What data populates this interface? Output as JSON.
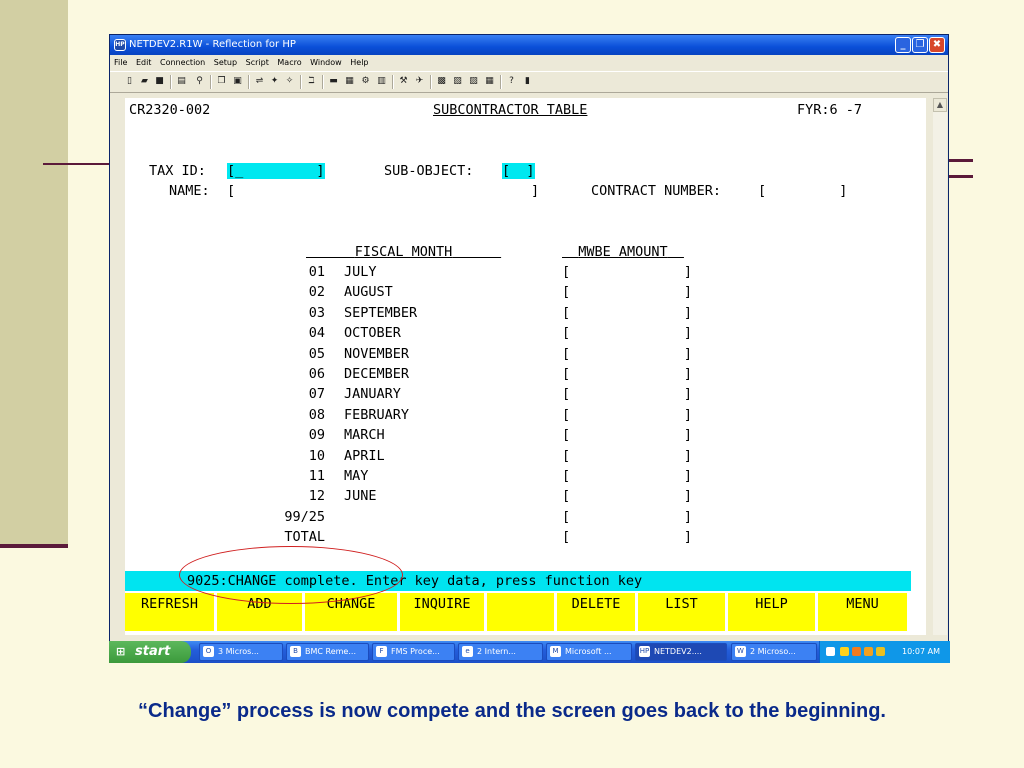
{
  "window": {
    "title": "NETDEV2.R1W - Reflection for HP",
    "app_icon": "HP",
    "buttons": {
      "minimize": "_",
      "maximize": "❐",
      "close": "✖"
    }
  },
  "menu": [
    "File",
    "Edit",
    "Connection",
    "Setup",
    "Script",
    "Macro",
    "Window",
    "Help"
  ],
  "toolbar_icons": [
    "new-icon",
    "open-icon",
    "save-icon",
    "print-icon",
    "find-icon",
    "copy-icon",
    "paste-icon",
    "connect-icon",
    "transfer-icon",
    "receive-icon",
    "macro-icon",
    "display-icon",
    "keyboard-icon",
    "settings-icon",
    "upload-icon",
    "tools-icon",
    "window-icon",
    "script-icon",
    "edit-icon",
    "terminal-icon",
    "help-cursor-icon",
    "book-icon"
  ],
  "terminal": {
    "screen_id": "CR2320-002",
    "screen_title": "SUBCONTRACTOR TABLE",
    "fyr": "FYR:6 -7",
    "tax_id_label": "TAX ID:",
    "tax_id_value": "[_         ]",
    "sub_object_label": "SUB-OBJECT:",
    "sub_object_value": "[  ]",
    "name_label": "NAME:",
    "name_open": "[",
    "name_close": "]",
    "contract_label": "CONTRACT NUMBER:",
    "contract_value": "[         ]",
    "col_fiscal_month": "FISCAL MONTH",
    "col_mwbe": "MWBE AMOUNT",
    "rows": [
      {
        "num": "01",
        "month": "JULY"
      },
      {
        "num": "02",
        "month": "AUGUST"
      },
      {
        "num": "03",
        "month": "SEPTEMBER"
      },
      {
        "num": "04",
        "month": "OCTOBER"
      },
      {
        "num": "05",
        "month": "NOVEMBER"
      },
      {
        "num": "06",
        "month": "DECEMBER"
      },
      {
        "num": "07",
        "month": "JANUARY"
      },
      {
        "num": "08",
        "month": "FEBRUARY"
      },
      {
        "num": "09",
        "month": "MARCH"
      },
      {
        "num": "10",
        "month": "APRIL"
      },
      {
        "num": "11",
        "month": "MAY"
      },
      {
        "num": "12",
        "month": "JUNE"
      },
      {
        "num": "99/25",
        "month": ""
      },
      {
        "num": "TOTAL",
        "month": ""
      }
    ],
    "amount_field": "[              ]",
    "status_message": "9025:CHANGE complete. Enter key data, press function key",
    "function_keys": [
      "REFRESH",
      "ADD",
      "CHANGE",
      "INQUIRE",
      "",
      "DELETE",
      "LIST",
      "HELP",
      "MENU"
    ]
  },
  "taskbar": {
    "start": "start",
    "tasks": [
      {
        "label": "3 Micros...",
        "icon": "O"
      },
      {
        "label": "BMC Reme...",
        "icon": "B"
      },
      {
        "label": "FMS Proce...",
        "icon": "F"
      },
      {
        "label": "2 Intern...",
        "icon": "e"
      },
      {
        "label": "Microsoft ...",
        "icon": "M"
      },
      {
        "label": "NETDEV2....",
        "icon": "HP"
      },
      {
        "label": "2 Microso...",
        "icon": "W"
      }
    ],
    "clock": "10:07 AM"
  },
  "caption": "“Change” process is now compete and the screen goes back to the beginning."
}
